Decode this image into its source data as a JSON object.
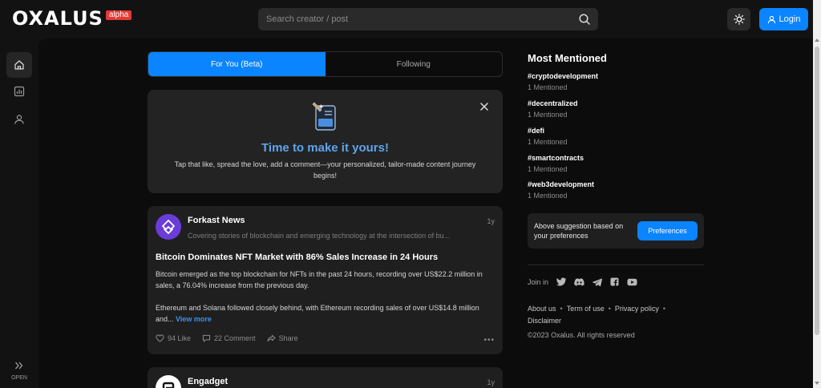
{
  "header": {
    "logo_text": "OXALUS",
    "logo_badge": "alpha",
    "search_placeholder": "Search creator / post",
    "login_label": "Login"
  },
  "rail": {
    "items": [
      "home-icon",
      "chart-icon",
      "user-icon"
    ],
    "open_label": "OPEN"
  },
  "feed": {
    "tabs": [
      {
        "label": "For You (Beta)",
        "active": true
      },
      {
        "label": "Following",
        "active": false
      }
    ],
    "promo": {
      "title": "Time to make it yours!",
      "text": "Tap that like, spread the love, add a comment—your personalized, tailor-made content journey begins!"
    },
    "posts": [
      {
        "source": "Forkast News",
        "description": "Covering stories of blockchain and emerging technology at the intersection of bu...",
        "age": "1y",
        "title": "Bitcoin Dominates NFT Market with 86% Sales Increase in 24 Hours",
        "body_1": "Bitcoin emerged as the top blockchain for NFTs in the past 24 hours, recording over US$22.2 million in sales, a 76.04% increase from the previous day.",
        "body_2": "Ethereum and Solana followed closely behind, with Ethereum recording sales of over US$14.8 million and...",
        "view_more": "View more",
        "likes": "94 Like",
        "comments": "22 Comment",
        "share": "Share"
      },
      {
        "source": "Engadget",
        "age": "1y"
      }
    ]
  },
  "sidebar": {
    "title": "Most Mentioned",
    "mentions": [
      {
        "tag": "#cryptodevelopment",
        "count": "1 Mentioned"
      },
      {
        "tag": "#decentralized",
        "count": "1 Mentioned"
      },
      {
        "tag": "#defi",
        "count": "1 Mentioned"
      },
      {
        "tag": "#smartcontracts",
        "count": "1 Mentioned"
      },
      {
        "tag": "#web3development",
        "count": "1 Mentioned"
      }
    ],
    "suggestion_text": "Above suggestion based on your preferences",
    "preferences_label": "Preferences",
    "join_label": "Join in",
    "social_icons": [
      "twitter-icon",
      "discord-icon",
      "telegram-icon",
      "facebook-icon",
      "youtube-icon"
    ],
    "footer_links": [
      "About us",
      "Term of use",
      "Privacy policy",
      "Disclaimer"
    ],
    "copyright": "©2023 Oxalus. All rights reserved"
  },
  "colors": {
    "accent": "#0a84ff",
    "badge": "#e53935",
    "promo_title": "#5ea4ee",
    "background": "#121212"
  }
}
